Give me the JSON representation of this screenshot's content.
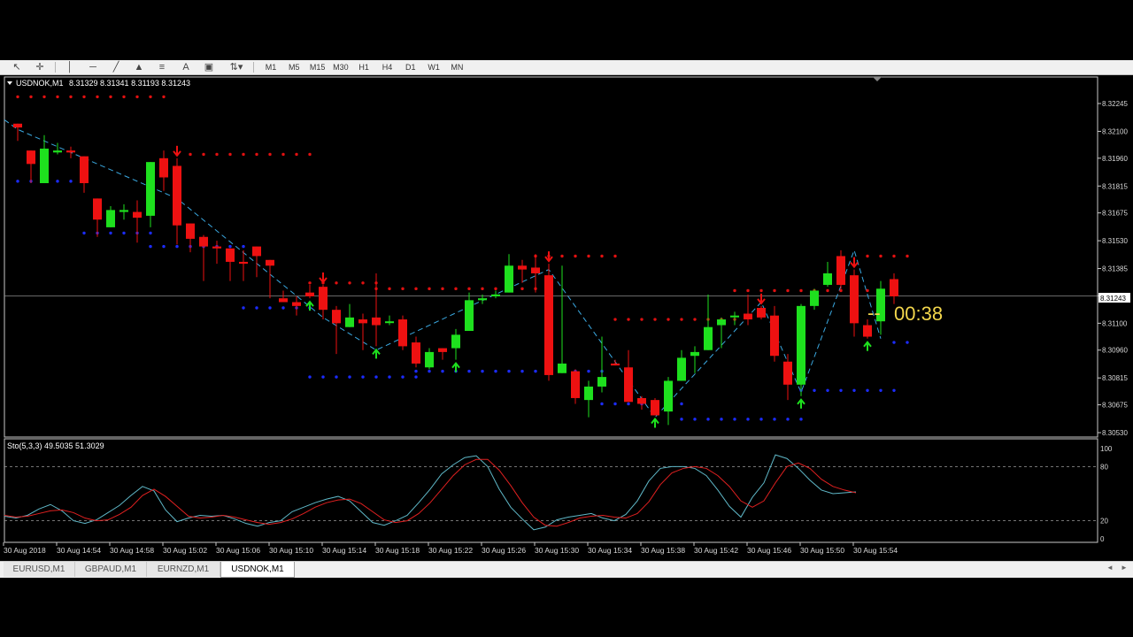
{
  "toolbar": {
    "tools": [
      "cursor-icon",
      "crosshair-icon",
      "vertical-line-icon",
      "horizontal-line-icon",
      "trendline-icon",
      "triangle-icon",
      "fibonacci-icon",
      "text-icon",
      "label-icon",
      "arrows-icon"
    ],
    "text_tool_glyph": "A",
    "timeframes": [
      "M1",
      "M5",
      "M15",
      "M30",
      "H1",
      "H4",
      "D1",
      "W1",
      "MN"
    ]
  },
  "chart_data": [
    {
      "type": "candlestick",
      "title": "USDNOK,M1",
      "ohlc_header": "8.31329 8.31341 8.31193 8.31243",
      "price_ticks": [
        "8.32245",
        "8.32100",
        "8.31960",
        "8.31815",
        "8.31675",
        "8.31530",
        "8.31385",
        "8.31243",
        "8.31100",
        "8.30960",
        "8.30815",
        "8.30675",
        "8.30530"
      ],
      "ylim": [
        8.3053,
        8.32245
      ],
      "current_price": 8.31243,
      "countdown": "00:38",
      "time_labels": [
        "30 Aug 2018",
        "30 Aug 14:54",
        "30 Aug 14:58",
        "30 Aug 15:02",
        "30 Aug 15:06",
        "30 Aug 15:10",
        "30 Aug 15:14",
        "30 Aug 15:18",
        "30 Aug 15:22",
        "30 Aug 15:26",
        "30 Aug 15:30",
        "30 Aug 15:34",
        "30 Aug 15:38",
        "30 Aug 15:42",
        "30 Aug 15:46",
        "30 Aug 15:50",
        "30 Aug 15:54"
      ],
      "candles": [
        [
          8.3214,
          8.3212,
          8.3214,
          8.3205
        ],
        [
          8.32,
          8.3193,
          8.32,
          8.3183
        ],
        [
          8.3183,
          8.3201,
          8.3208,
          8.3183
        ],
        [
          8.3199,
          8.32,
          8.3204,
          8.3198
        ],
        [
          8.32,
          8.3199,
          8.3202,
          8.3196
        ],
        [
          8.3197,
          8.3183,
          8.3197,
          8.3178
        ],
        [
          8.3175,
          8.3164,
          8.3175,
          8.3155
        ],
        [
          8.316,
          8.3169,
          8.3171,
          8.316
        ],
        [
          8.3168,
          8.3169,
          8.3172,
          8.3164
        ],
        [
          8.3168,
          8.3165,
          8.3174,
          8.3152
        ],
        [
          8.3166,
          8.3194,
          8.3194,
          8.316
        ],
        [
          8.3196,
          8.3186,
          8.32,
          8.3179
        ],
        [
          8.3192,
          8.3161,
          8.3196,
          8.3151
        ],
        [
          8.3162,
          8.3154,
          8.3162,
          8.3147
        ],
        [
          8.3155,
          8.315,
          8.3156,
          8.3132
        ],
        [
          8.315,
          8.3149,
          8.3153,
          8.3141
        ],
        [
          8.3149,
          8.3142,
          8.3149,
          8.3132
        ],
        [
          8.3142,
          8.3141,
          8.3148,
          8.3132
        ],
        [
          8.315,
          8.3145,
          8.315,
          8.3134
        ],
        [
          8.3143,
          8.314,
          8.3143,
          8.3123
        ],
        [
          8.3123,
          8.3121,
          8.3127,
          8.3123
        ],
        [
          8.3121,
          8.3119,
          8.3124,
          8.3114
        ],
        [
          8.3126,
          8.3124,
          8.313,
          8.3123
        ],
        [
          8.3129,
          8.3117,
          8.313,
          8.3112
        ],
        [
          8.3117,
          8.311,
          8.3119,
          8.3094
        ],
        [
          8.3108,
          8.3113,
          8.312,
          8.3108
        ],
        [
          8.3112,
          8.311,
          8.3115,
          8.3096
        ],
        [
          8.3113,
          8.3109,
          8.3136,
          8.3098
        ],
        [
          8.3111,
          8.3111,
          8.3114,
          8.3109
        ],
        [
          8.3112,
          8.3098,
          8.3114,
          8.3096
        ],
        [
          8.31,
          8.3089,
          8.3103,
          8.3087
        ],
        [
          8.3087,
          8.3095,
          8.3097,
          8.3086
        ],
        [
          8.3097,
          8.3095,
          8.3097,
          8.3091
        ],
        [
          8.3097,
          8.3104,
          8.3107,
          8.3091
        ],
        [
          8.3106,
          8.3122,
          8.3126,
          8.3106
        ],
        [
          8.3122,
          8.3123,
          8.3125,
          8.312
        ],
        [
          8.3124,
          8.3125,
          8.3127,
          8.3123
        ],
        [
          8.3126,
          8.314,
          8.3146,
          8.3126
        ],
        [
          8.314,
          8.3138,
          8.3143,
          8.3131
        ],
        [
          8.3139,
          8.3136,
          8.3146,
          8.3126
        ],
        [
          8.3135,
          8.3083,
          8.3141,
          8.308
        ],
        [
          8.3084,
          8.3089,
          8.314,
          8.3084
        ],
        [
          8.3085,
          8.3071,
          8.3086,
          8.3068
        ],
        [
          8.307,
          8.3077,
          8.308,
          8.3061
        ],
        [
          8.3077,
          8.3082,
          8.3103,
          8.3074
        ],
        [
          8.3089,
          8.3088,
          8.3091,
          8.3088
        ],
        [
          8.3087,
          8.3069,
          8.3096,
          8.3069
        ],
        [
          8.3071,
          8.3068,
          8.3072,
          8.3065
        ],
        [
          8.307,
          8.3062,
          8.3071,
          8.3062
        ],
        [
          8.3064,
          8.308,
          8.3082,
          8.3057
        ],
        [
          8.308,
          8.3092,
          8.3096,
          8.308
        ],
        [
          8.3093,
          8.3095,
          8.3098,
          8.3084
        ],
        [
          8.3096,
          8.3108,
          8.3125,
          8.3096
        ],
        [
          8.3109,
          8.3112,
          8.3113,
          8.3097
        ],
        [
          8.3114,
          8.3114,
          8.3116,
          8.3109
        ],
        [
          8.3115,
          8.3112,
          8.3125,
          8.3109
        ],
        [
          8.3118,
          8.3113,
          8.3119,
          8.3112
        ],
        [
          8.3114,
          8.3093,
          8.3119,
          8.309
        ],
        [
          8.309,
          8.3078,
          8.3094,
          8.307
        ],
        [
          8.3078,
          8.3119,
          8.312,
          8.3072
        ],
        [
          8.3119,
          8.3127,
          8.3128,
          8.3117
        ],
        [
          8.313,
          8.3136,
          8.3142,
          8.3129
        ],
        [
          8.3145,
          8.313,
          8.3148,
          8.3128
        ],
        [
          8.3135,
          8.311,
          8.3138,
          8.3103
        ],
        [
          8.3109,
          8.3103,
          8.3112,
          8.3102
        ],
        [
          8.3111,
          8.3128,
          8.3132,
          8.3104
        ],
        [
          8.3133,
          8.3124,
          8.3136,
          8.312
        ]
      ],
      "zigzag": [
        [
          0,
          8.3211
        ],
        [
          12,
          8.3175
        ],
        [
          23,
          8.3113
        ],
        [
          27,
          8.3096
        ],
        [
          40,
          8.3138
        ],
        [
          48,
          8.3061
        ],
        [
          56,
          8.3121
        ],
        [
          59,
          8.3074
        ],
        [
          63,
          8.3148
        ],
        [
          65,
          8.3102
        ]
      ],
      "resistance_dots": [
        [
          0,
          11,
          8.3228
        ],
        [
          12,
          22,
          8.3198
        ],
        [
          22,
          27,
          8.3131
        ],
        [
          27,
          39,
          8.3128
        ],
        [
          39,
          45,
          8.3145
        ],
        [
          45,
          54,
          8.3112
        ],
        [
          54,
          64,
          8.3127
        ],
        [
          64,
          67,
          8.3145
        ]
      ],
      "support_dots": [
        [
          0,
          5,
          8.3184
        ],
        [
          5,
          10,
          8.3157
        ],
        [
          10,
          17,
          8.315
        ],
        [
          17,
          22,
          8.3118
        ],
        [
          22,
          30,
          8.3082
        ],
        [
          30,
          44,
          8.3085
        ],
        [
          44,
          50,
          8.3068
        ],
        [
          50,
          59,
          8.306
        ],
        [
          59,
          66,
          8.3075
        ],
        [
          66,
          67,
          8.31
        ]
      ],
      "sell_arrows": [
        12,
        23,
        40,
        56,
        63
      ],
      "buy_arrows": [
        22,
        27,
        33,
        48,
        59,
        64
      ]
    },
    {
      "type": "line",
      "title": "Sto(5,3,3) 49.5035 51.3029",
      "ylim": [
        0,
        100
      ],
      "levels": [
        20,
        80
      ],
      "y_ticks": [
        "100",
        "80",
        "20",
        "0"
      ],
      "series": [
        {
          "name": "main",
          "color": "#5fb8c8",
          "values": [
            25,
            23,
            26,
            33,
            38,
            31,
            20,
            17,
            21,
            29,
            37,
            48,
            58,
            53,
            32,
            19,
            23,
            26,
            25,
            26,
            22,
            17,
            14,
            18,
            20,
            30,
            35,
            40,
            44,
            47,
            42,
            30,
            18,
            15,
            20,
            26,
            40,
            55,
            72,
            82,
            90,
            92,
            80,
            55,
            35,
            22,
            10,
            13,
            21,
            24,
            26,
            28,
            23,
            20,
            27,
            42,
            64,
            78,
            80,
            80,
            78,
            70,
            54,
            36,
            24,
            46,
            62,
            93,
            89,
            78,
            65,
            54,
            50,
            51,
            52
          ]
        },
        {
          "name": "signal",
          "color": "#e02020",
          "values": [
            26,
            24,
            25,
            28,
            31,
            32,
            29,
            23,
            20,
            21,
            27,
            35,
            48,
            55,
            47,
            36,
            25,
            23,
            24,
            26,
            24,
            21,
            18,
            16,
            18,
            22,
            28,
            35,
            40,
            43,
            44,
            39,
            30,
            21,
            18,
            20,
            28,
            40,
            55,
            70,
            82,
            88,
            88,
            76,
            59,
            40,
            24,
            15,
            14,
            18,
            23,
            25,
            26,
            24,
            23,
            28,
            41,
            60,
            73,
            78,
            80,
            78,
            70,
            58,
            42,
            35,
            42,
            62,
            80,
            84,
            78,
            66,
            58,
            54,
            51
          ]
        }
      ]
    }
  ],
  "price_label": "8.31243",
  "tabs": [
    "EURUSD,M1",
    "GBPAUD,M1",
    "EURNZD,M1",
    "USDNOK,M1"
  ],
  "active_tab": "USDNOK,M1",
  "colors": {
    "bull": "#1ee01e",
    "bear": "#ee1111",
    "resistance": "#e01010",
    "support": "#1c2cff",
    "zigzag": "#3aa8e0",
    "countdown": "#f2d64c",
    "grid_text": "#d8d8d8"
  }
}
